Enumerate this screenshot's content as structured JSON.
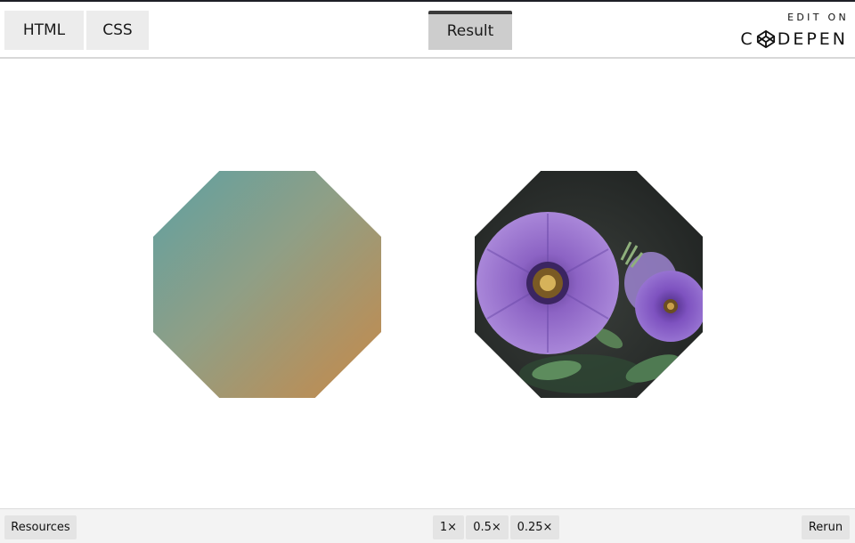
{
  "tabs": {
    "html_label": "HTML",
    "css_label": "CSS",
    "result_label": "Result"
  },
  "codepen": {
    "edit_on": "EDIT ON",
    "wordmark_before": "C",
    "wordmark_after": "DEPEN"
  },
  "shapes": {
    "gradient_colors": [
      "#5fa0a2",
      "#8f9f86",
      "#b3915f",
      "#c48a4b"
    ],
    "photo_icon": "purple-petunia-flowers-photo"
  },
  "bottom": {
    "resources_label": "Resources",
    "zoom_options": [
      "1×",
      "0.5×",
      "0.25×"
    ],
    "rerun_label": "Rerun"
  }
}
